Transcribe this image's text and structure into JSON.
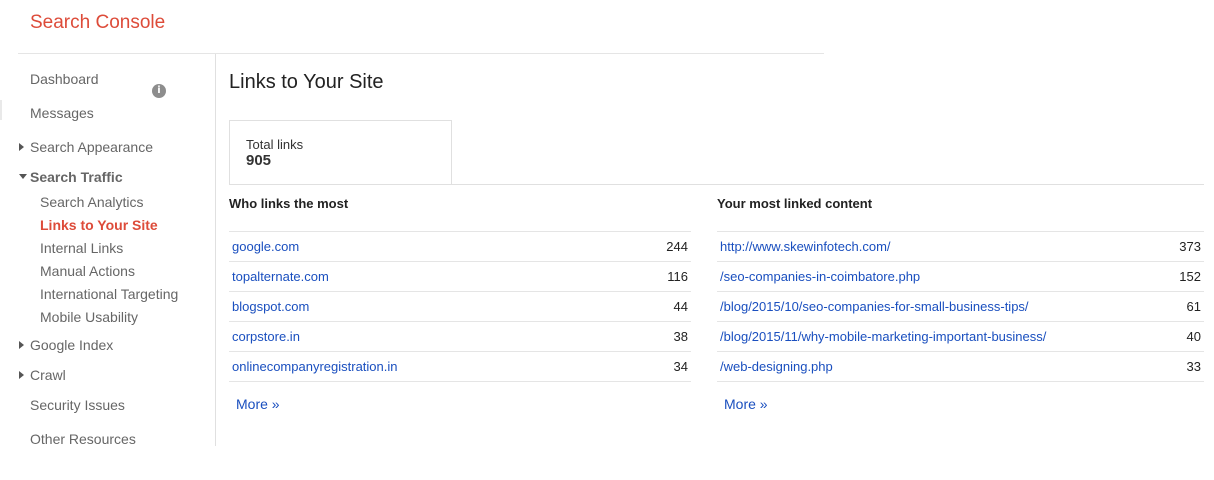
{
  "app": {
    "title": "Search Console"
  },
  "sidebar": {
    "dashboard": "Dashboard",
    "messages": "Messages",
    "search_appearance": "Search Appearance",
    "search_traffic": "Search Traffic",
    "search_traffic_items": [
      "Search Analytics",
      "Links to Your Site",
      "Internal Links",
      "Manual Actions",
      "International Targeting",
      "Mobile Usability"
    ],
    "google_index": "Google Index",
    "crawl": "Crawl",
    "security_issues": "Security Issues",
    "other_resources": "Other Resources",
    "accent_color": "#dd4b39"
  },
  "main": {
    "title": "Links to Your Site",
    "summary": {
      "label": "Total links",
      "value": "905"
    },
    "who_links": {
      "title": "Who links the most",
      "rows": [
        {
          "domain": "google.com",
          "count": "244"
        },
        {
          "domain": "topalternate.com",
          "count": "116"
        },
        {
          "domain": "blogspot.com",
          "count": "44"
        },
        {
          "domain": "corpstore.in",
          "count": "38"
        },
        {
          "domain": "onlinecompanyregistration.in",
          "count": "34"
        }
      ],
      "more": "More »"
    },
    "most_linked": {
      "title": "Your most linked content",
      "rows": [
        {
          "path": "http://www.skewinfotech.com/",
          "count": "373"
        },
        {
          "path": "/seo-companies-in-coimbatore.php",
          "count": "152"
        },
        {
          "path": "/blog/2015/10/seo-companies-for-small-business-tips/",
          "count": "61"
        },
        {
          "path": "/blog/2015/11/why-mobile-marketing-important-business/",
          "count": "40"
        },
        {
          "path": "/web-designing.php",
          "count": "33"
        }
      ],
      "more": "More »"
    },
    "link_color": "#1a4fbf"
  }
}
